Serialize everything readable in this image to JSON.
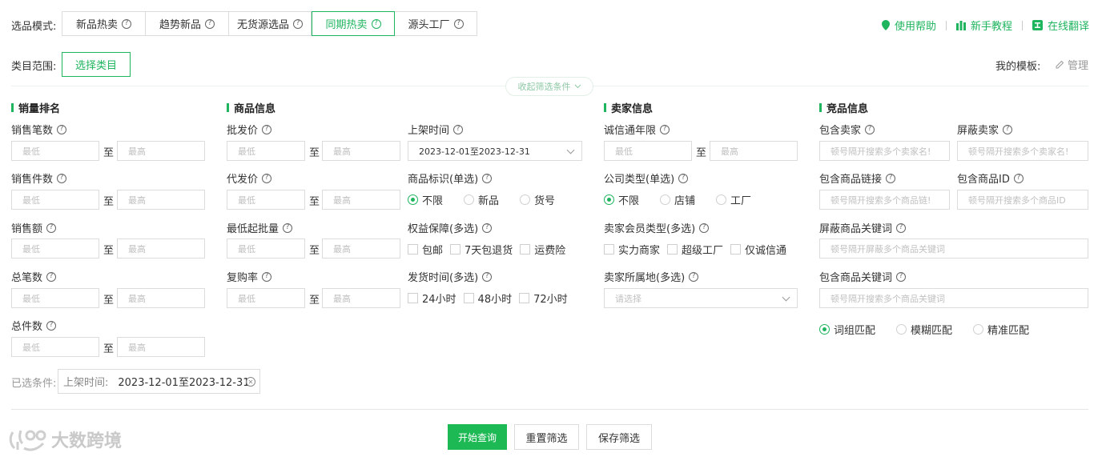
{
  "mode": {
    "label": "选品模式:",
    "tabs": [
      {
        "label": "新品热卖"
      },
      {
        "label": "趋势新品"
      },
      {
        "label": "无货源选品"
      },
      {
        "label": "同期热卖"
      },
      {
        "label": "源头工厂"
      }
    ],
    "active_index": 3
  },
  "help": {
    "usage": "使用帮助",
    "tutorial": "新手教程",
    "translate": "在线翻译"
  },
  "category": {
    "label": "类目范围:",
    "button": "选择类目"
  },
  "template": {
    "label": "我的模板:",
    "manage": "管理"
  },
  "collapse_label": "收起筛选条件",
  "sections": {
    "sales": "销量排名",
    "product": "商品信息",
    "seller": "卖家信息",
    "competitor": "竞品信息"
  },
  "fields": {
    "sales_count": "销售笔数",
    "sales_qty": "销售件数",
    "sales_amount": "销售额",
    "total_orders": "总笔数",
    "total_qty": "总件数",
    "wholesale_price": "批发价",
    "dropship_price": "代发价",
    "min_batch": "最低起批量",
    "repurchase_rate": "复购率",
    "list_time": "上架时间",
    "product_tag": "商品标识(单选)",
    "guarantee": "权益保障(多选)",
    "ship_time": "发货时间(多选)",
    "cxt_years": "诚信通年限",
    "company_type": "公司类型(单选)",
    "member_type": "卖家会员类型(多选)",
    "seller_region": "卖家所属地(多选)",
    "include_seller": "包含卖家",
    "block_seller": "屏蔽卖家",
    "include_link": "包含商品链接",
    "include_id": "包含商品ID",
    "block_keyword": "屏蔽商品关键词",
    "include_keyword": "包含商品关键词"
  },
  "range": {
    "min": "最低",
    "max": "最高",
    "to": "至"
  },
  "list_time_value": "2023-12-01至2023-12-31",
  "product_tag_options": [
    "不限",
    "新品",
    "货号"
  ],
  "guarantee_options": [
    "包邮",
    "7天包退货",
    "运费险"
  ],
  "ship_time_options": [
    "24小时",
    "48小时",
    "72小时"
  ],
  "company_type_options": [
    "不限",
    "店铺",
    "工厂"
  ],
  "member_type_options": [
    "实力商家",
    "超级工厂",
    "仅诚信通"
  ],
  "region_placeholder": "请选择",
  "placeholders": {
    "include_seller": "顿号隔开搜索多个卖家名!",
    "block_seller": "顿号隔开搜索多个卖家名!",
    "include_link": "顿号隔开搜索多个商品链!",
    "include_id": "顿号隔开搜索多个商品ID",
    "block_keyword": "顿号隔开屏蔽多个商品关键词",
    "include_keyword": "顿号隔开搜索多个商品关键词"
  },
  "match_options": [
    "词组匹配",
    "模糊匹配",
    "精准匹配"
  ],
  "selected": {
    "label": "已选条件:",
    "chip_key": "上架时间:",
    "chip_value": "2023-12-01至2023-12-31"
  },
  "buttons": {
    "search": "开始查询",
    "reset": "重置筛选",
    "save": "保存筛选"
  },
  "watermark": "大数跨境",
  "colors": {
    "accent": "#1fb45e"
  }
}
